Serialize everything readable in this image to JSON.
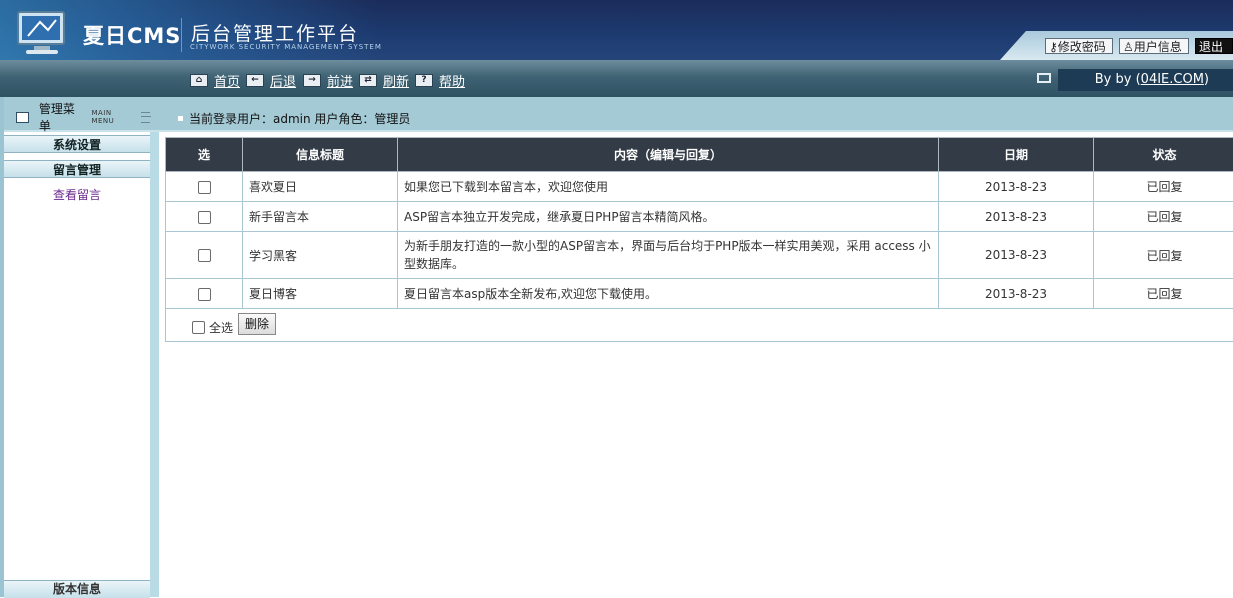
{
  "header": {
    "logo_main": "夏日CMS",
    "logo_sub": "后台管理工作平台",
    "logo_en": "CITYWORK SECURITY MANAGEMENT SYSTEM",
    "top_buttons": [
      "修改密码",
      "用户信息",
      "退出"
    ]
  },
  "nav": {
    "items": [
      {
        "icon": "home-icon",
        "label": "首页"
      },
      {
        "icon": "back-arrow-icon",
        "label": "后退"
      },
      {
        "icon": "forward-arrow-icon",
        "label": "前进"
      },
      {
        "icon": "refresh-icon",
        "label": "刷新"
      },
      {
        "icon": "help-icon",
        "label": "帮助"
      }
    ],
    "byline_prefix": "By by (",
    "byline_link": "04IE.COM",
    "byline_suffix": ")"
  },
  "menu": {
    "title": "管理菜单",
    "title_en": "MAIN MENU",
    "sections": [
      "系统设置",
      "留言管理"
    ],
    "link": "查看留言",
    "bottom": "版本信息"
  },
  "user_info": "当前登录用户：admin  用户角色：管理员",
  "table": {
    "headers": [
      "选",
      "信息标题",
      "内容（编辑与回复）",
      "日期",
      "状态"
    ],
    "rows": [
      {
        "title": "喜欢夏日",
        "content": "如果您已下载到本留言本，欢迎您使用",
        "date": "2013-8-23",
        "status": "已回复"
      },
      {
        "title": "新手留言本",
        "content": "ASP留言本独立开发完成，继承夏日PHP留言本精简风格。",
        "date": "2013-8-23",
        "status": "已回复"
      },
      {
        "title": "学习黑客",
        "content": "为新手朋友打造的一款小型的ASP留言本，界面与后台均于PHP版本一样实用美观，采用 access 小型数据库。",
        "date": "2013-8-23",
        "status": "已回复"
      },
      {
        "title": "夏日博客",
        "content": "夏日留言本asp版本全新发布,欢迎您下载使用。",
        "date": "2013-8-23",
        "status": "已回复"
      }
    ],
    "select_all": "全选",
    "delete_button": "删除"
  },
  "colors": {
    "header_bg": "#1d3a6f",
    "table_head": "#333c46",
    "link_purple": "#6a2a8a",
    "accent_blue": "#a4cad6"
  }
}
